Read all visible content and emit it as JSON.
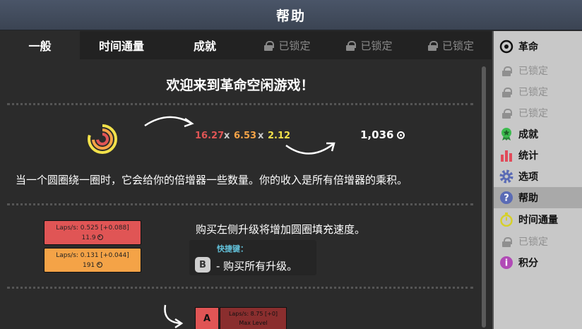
{
  "window": {
    "title": "帮助"
  },
  "tabs": [
    {
      "label": "一般",
      "locked": false
    },
    {
      "label": "时间通量",
      "locked": false
    },
    {
      "label": "成就",
      "locked": false
    },
    {
      "label": "已锁定",
      "locked": true
    },
    {
      "label": "已锁定",
      "locked": true
    },
    {
      "label": "已锁定",
      "locked": true
    }
  ],
  "help": {
    "welcome": "欢迎来到革命空闲游戏！",
    "multipliers": {
      "m1": "16.27",
      "m2": "6.53",
      "m3": "2.12",
      "times": "x"
    },
    "income": "1,036",
    "explain": "当一个圆圈绕一圈时，它会给你的倍增器一些数量。你的收入是所有倍增器的乘积。",
    "upgrades": [
      {
        "rate": "Laps/s: 0.525 [+0.088]",
        "cost": "11.9",
        "color": "#e05555"
      },
      {
        "rate": "Laps/s: 0.131 [+0.044]",
        "cost": "191",
        "color": "#f4a347"
      }
    ],
    "buy_tip": "购买左侧升级将增加圆圈填充速度。",
    "hotkey_label": "快捷键：",
    "hotkey_key": "B",
    "hotkey_text": "- 购买所有升级。",
    "next_key": "A",
    "next_rate": "Laps/s: 8.75 [+0]",
    "next_status": "Max Level"
  },
  "sidebar": {
    "items": [
      {
        "label": "革命",
        "icon": "revolution-icon"
      },
      {
        "label": "已锁定",
        "icon": "lock-icon"
      },
      {
        "label": "已锁定",
        "icon": "lock-icon"
      },
      {
        "label": "已锁定",
        "icon": "lock-icon"
      },
      {
        "label": "成就",
        "icon": "achievement-icon"
      },
      {
        "label": "统计",
        "icon": "stats-icon"
      },
      {
        "label": "选项",
        "icon": "gear-icon"
      },
      {
        "label": "帮助",
        "icon": "help-icon",
        "selected": true
      },
      {
        "label": "时间通量",
        "icon": "stopwatch-icon"
      },
      {
        "label": "已锁定",
        "icon": "lock-icon"
      },
      {
        "label": "积分",
        "icon": "info-icon"
      }
    ]
  },
  "colors": {
    "red": "#e05555",
    "orange": "#f4a347",
    "yellow": "#f2e14a",
    "accent_blue": "#62c0d9"
  }
}
